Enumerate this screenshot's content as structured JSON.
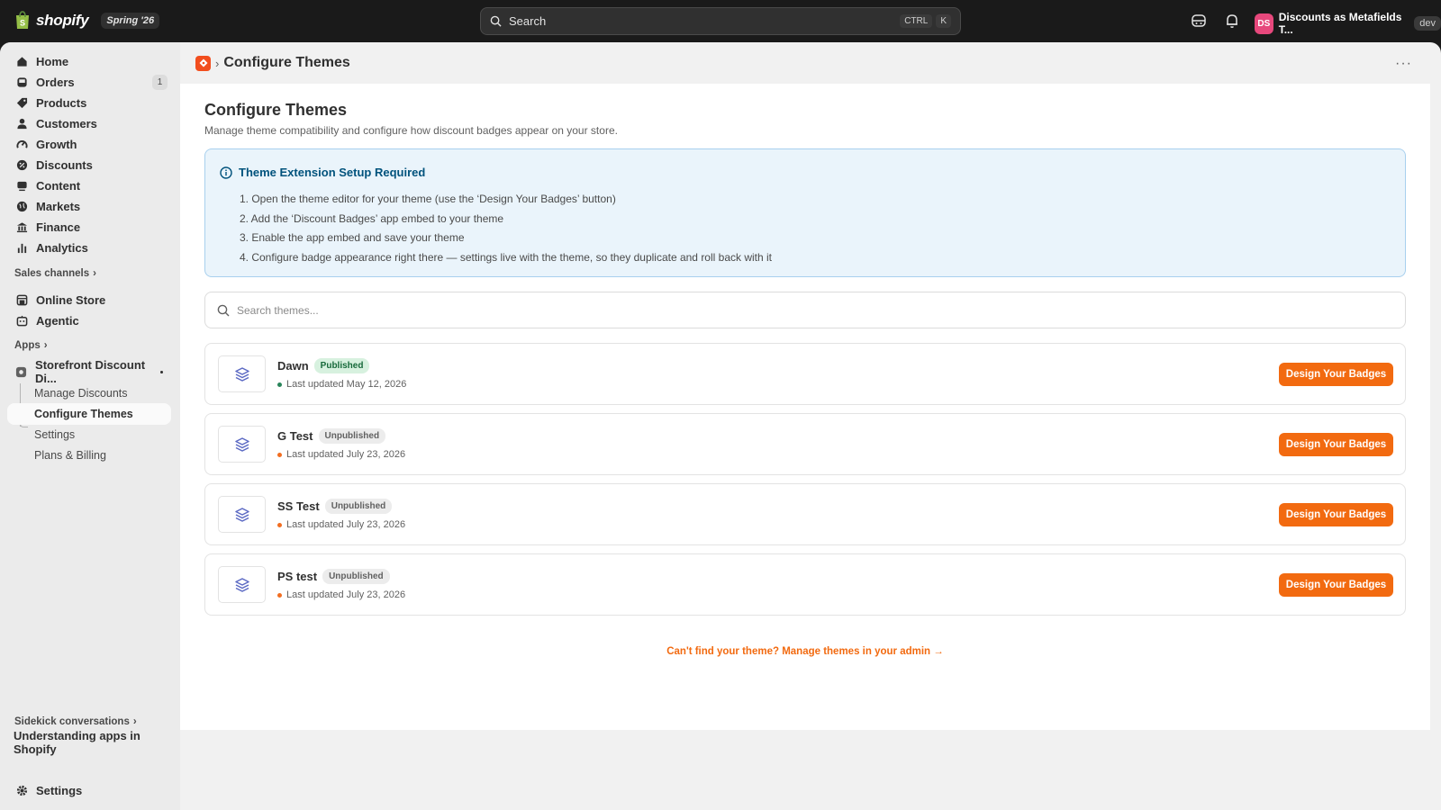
{
  "topbar": {
    "brand": "shopify",
    "season": "Spring '26",
    "search_placeholder": "Search",
    "shortcut_ctrl": "CTRL",
    "shortcut_key": "K",
    "avatar_initials": "DS",
    "store_name": "Discounts as Metafields T...",
    "env_tag": "dev"
  },
  "sidebar": {
    "items": [
      {
        "label": "Home",
        "icon": "home-icon"
      },
      {
        "label": "Orders",
        "icon": "inbox-icon",
        "count": "1"
      },
      {
        "label": "Products",
        "icon": "tag-icon"
      },
      {
        "label": "Customers",
        "icon": "person-icon"
      },
      {
        "label": "Growth",
        "icon": "gauge-icon"
      },
      {
        "label": "Discounts",
        "icon": "discount-icon"
      },
      {
        "label": "Content",
        "icon": "content-icon"
      },
      {
        "label": "Markets",
        "icon": "globe-icon"
      },
      {
        "label": "Finance",
        "icon": "bank-icon"
      },
      {
        "label": "Analytics",
        "icon": "bar-chart-icon"
      }
    ],
    "sales_channels_heading": "Sales channels",
    "channels": [
      {
        "label": "Online Store",
        "icon": "store-icon"
      },
      {
        "label": "Agentic",
        "icon": "robot-icon"
      }
    ],
    "apps_heading": "Apps",
    "app_name": "Storefront Discount Di...",
    "app_subitems": [
      "Manage Discounts",
      "Configure Themes",
      "Settings",
      "Plans & Billing"
    ],
    "active_subitem": "Configure Themes",
    "sidekick_heading": "Sidekick conversations",
    "sidekick_item": "Understanding apps in Shopify",
    "settings_label": "Settings"
  },
  "header": {
    "breadcrumb_title": "Configure Themes",
    "more": "···"
  },
  "main": {
    "title": "Configure Themes",
    "subtitle": "Manage theme compatibility and configure how discount badges appear on your store.",
    "banner": {
      "title": "Theme Extension Setup Required",
      "steps": [
        "1. Open the theme editor for your theme (use the ‘Design Your Badges’ button)",
        "2. Add the ‘Discount Badges’ app embed to your theme",
        "3. Enable the app embed and save your theme",
        "4. Configure badge appearance right there — settings live with the theme, so they duplicate and roll back with it"
      ]
    },
    "theme_search_placeholder": "Search themes...",
    "themes": [
      {
        "name": "Dawn",
        "status": "Published",
        "updated": "Last updated May 12, 2026",
        "button": "Design Your Badges"
      },
      {
        "name": "G Test",
        "status": "Unpublished",
        "updated": "Last updated July 23, 2026",
        "button": "Design Your Badges"
      },
      {
        "name": "SS Test",
        "status": "Unpublished",
        "updated": "Last updated July 23, 2026",
        "button": "Design Your Badges"
      },
      {
        "name": "PS test",
        "status": "Unpublished",
        "updated": "Last updated July 23, 2026",
        "button": "Design Your Badges"
      }
    ],
    "footer_link": "Can't find your theme? Manage themes in your admin →"
  },
  "colors": {
    "accent": "#f26a10",
    "published_bg": "#d7f1df",
    "info_bg": "#eaf4fb"
  }
}
